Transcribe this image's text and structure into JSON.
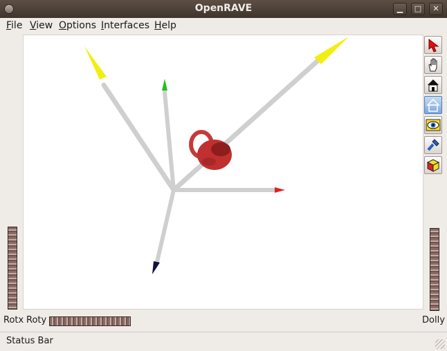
{
  "window": {
    "title": "OpenRAVE",
    "minimize_glyph": "▁",
    "maximize_glyph": "□",
    "close_glyph": "✕"
  },
  "menu": [
    {
      "label": "File",
      "accel": "F",
      "rest": "ile"
    },
    {
      "label": "View",
      "accel": "V",
      "rest": "iew"
    },
    {
      "label": "Options",
      "accel": "O",
      "rest": "ptions"
    },
    {
      "label": "Interfaces",
      "accel": "I",
      "rest": "nterfaces"
    },
    {
      "label": "Help",
      "accel": "H",
      "rest": "elp"
    }
  ],
  "toolbar": {
    "select": "select-arrow-icon",
    "hand": "hand-icon",
    "home": "home-icon",
    "set_home": "set-home-icon",
    "view_all": "eye-icon",
    "seek": "flashlight-icon",
    "projection": "cube-icon"
  },
  "controls": {
    "rotx_label": "Rotx",
    "roty_label": "Roty",
    "dolly_label": "Dolly"
  },
  "status": {
    "text": "Status Bar"
  },
  "colors": {
    "titlebar": "#4a3f36",
    "axis_x": "#e02020",
    "axis_y": "#20c020",
    "axis_z": "#101040",
    "axis_highlight": "#ffff00",
    "mug": "#c03030"
  }
}
